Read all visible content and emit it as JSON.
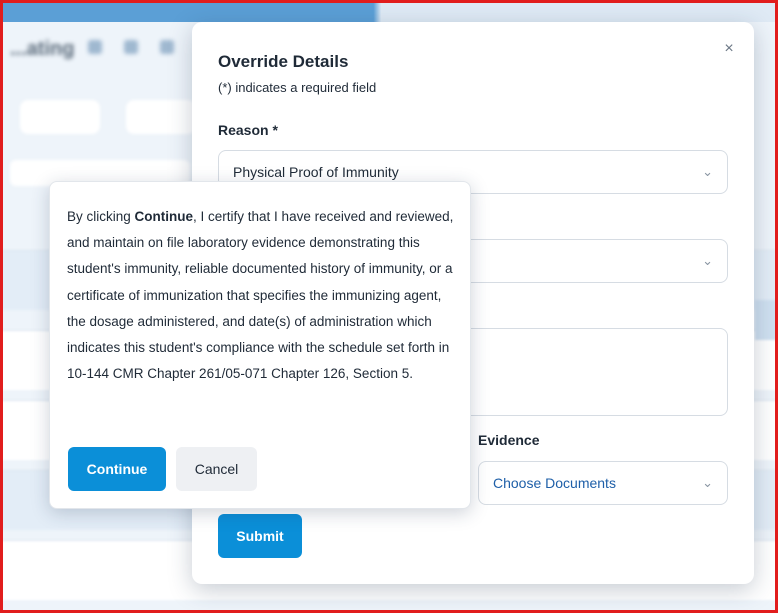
{
  "background": {
    "title": "...ating"
  },
  "modal": {
    "title": "Override Details",
    "subtitle": "(*) indicates a required field",
    "close_icon": "×",
    "reason_label": "Reason *",
    "reason_value": "Physical Proof of Immunity",
    "second_select_value": "",
    "evidence_label": "Evidence",
    "evidence_placeholder": "Choose Documents",
    "submit_label": "Submit"
  },
  "popover": {
    "text_prefix": "By clicking ",
    "text_bold": "Continue",
    "text_suffix": ", I certify that I have received and reviewed, and maintain on file laboratory evidence demonstrating this student's immunity, reliable documented history of immunity, or a certificate of immunization that specifies the immunizing agent, the dosage administered, and date(s) of administration which indicates this student's compliance with the schedule set forth in 10-144 CMR Chapter 261/05-071 Chapter 126, Section 5.",
    "continue_label": "Continue",
    "cancel_label": "Cancel"
  },
  "icons": {
    "chevron": "chevron-down-icon",
    "close": "close-icon"
  },
  "colors": {
    "primary": "#0b8fd8",
    "link": "#1e5fa8",
    "frame": "#e11d1d"
  }
}
